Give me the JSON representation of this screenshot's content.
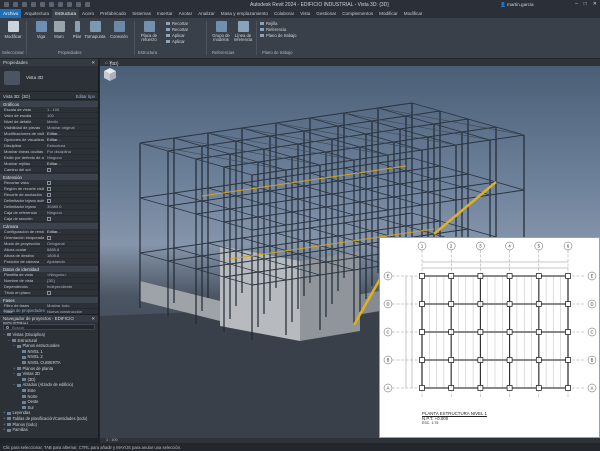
{
  "app": {
    "title": "Autodesk Revit 2024 - EDIFICIO INDUSTRIAL - Vista 3D: {3D}",
    "user": "martin.garcia",
    "window_controls": [
      "–",
      "□",
      "✕"
    ]
  },
  "ribbon_tabs": [
    "Archivo",
    "Arquitectura",
    "Estructura",
    "Acero",
    "Prefabricado",
    "Sistemas",
    "Insertar",
    "Anotar",
    "Analizar",
    "Masa y emplazamiento",
    "Colaborar",
    "Vista",
    "Gestionar",
    "Complementos",
    "Modificar",
    "Modificar"
  ],
  "ribbon": {
    "buttons": [
      {
        "label": "Modificar",
        "icon": "cursor-icon"
      },
      {
        "label": "Viga",
        "icon": "beam-icon"
      },
      {
        "label": "Muro",
        "icon": "wall-icon"
      },
      {
        "label": "Pilar",
        "icon": "column-icon"
      },
      {
        "label": "Tornapunta",
        "icon": "brace-icon"
      },
      {
        "label": "Conexión",
        "icon": "connection-icon"
      },
      {
        "label": "Placa de refuerzo",
        "icon": "plate-icon"
      },
      {
        "label": "Grupo de modelos",
        "icon": "group-icon"
      },
      {
        "label": "Línea de referencia",
        "icon": "ref-line-icon"
      }
    ],
    "list_items": [
      "Recortar",
      "Recortar",
      "Aplicar",
      "Aplicar"
    ],
    "ref_items": [
      "Rejilla",
      "Referencia",
      "Plano de trabajo"
    ],
    "panels": [
      "Seleccionar",
      "Propiedades",
      "Estructura",
      "Referencias",
      "Plano de trabajo"
    ]
  },
  "properties": {
    "title": "Propiedades",
    "type_name": "Vista 3D",
    "instance_filter": "Vista 3D: {3D}",
    "edit_type": "Editar tipo",
    "sections": [
      {
        "name": "Gráficos",
        "rows": [
          {
            "k": "Escala de vista",
            "v": "1 : 100"
          },
          {
            "k": "Valor de escala",
            "v": "100"
          },
          {
            "k": "Nivel de detalle",
            "v": "Medio"
          },
          {
            "k": "Visibilidad de piezas",
            "v": "Mostrar original"
          },
          {
            "k": "Modificaciones de visibilidad",
            "v": "Editar..."
          },
          {
            "k": "Opciones de visualización",
            "v": "Editar..."
          },
          {
            "k": "Disciplina",
            "v": "Estructura"
          },
          {
            "k": "Mostrar líneas ocultas",
            "v": "Por disciplina"
          },
          {
            "k": "Estilo por defecto de análisis",
            "v": "Ninguno"
          },
          {
            "k": "Mostrar rejillas",
            "v": "Editar..."
          },
          {
            "k": "Camino del sol",
            "v": ""
          }
        ]
      },
      {
        "name": "Extensión",
        "rows": [
          {
            "k": "Recortar vista",
            "v": ""
          },
          {
            "k": "Región de recorte visible",
            "v": ""
          },
          {
            "k": "Recorte de anotación",
            "v": ""
          },
          {
            "k": "Delimitador lejano activo",
            "v": ""
          },
          {
            "k": "Delimitador lejano",
            "v": "30480.0"
          },
          {
            "k": "Caja de referencia",
            "v": "Ninguno"
          },
          {
            "k": "Caja de sección",
            "v": ""
          }
        ]
      },
      {
        "name": "Cámara",
        "rows": [
          {
            "k": "Configuración de render",
            "v": "Editar..."
          },
          {
            "k": "Orientación bloqueada",
            "v": ""
          },
          {
            "k": "Modo de proyección",
            "v": "Ortogonal"
          },
          {
            "k": "Altura ocular",
            "v": "6885.8"
          },
          {
            "k": "Altura de destino",
            "v": "1808.8"
          },
          {
            "k": "Posición de cámara",
            "v": "Ajustando"
          }
        ]
      },
      {
        "name": "Datos de identidad",
        "rows": [
          {
            "k": "Plantilla de vista",
            "v": "<Ninguno>"
          },
          {
            "k": "Nombre de vista",
            "v": "{3D}"
          },
          {
            "k": "Dependencia",
            "v": "Independiente"
          },
          {
            "k": "Título en plano",
            "v": ""
          }
        ]
      },
      {
        "name": "Fases",
        "rows": [
          {
            "k": "Filtro de fases",
            "v": "Mostrar todo"
          },
          {
            "k": "Fase",
            "v": "Nueva construcción"
          }
        ]
      }
    ],
    "help_link": "Ayuda de propiedades",
    "apply": "Aplicar"
  },
  "browser": {
    "title": "Navegador de proyectos - EDIFICIO INDUSTRIAL",
    "search_placeholder": "Buscar",
    "tree": [
      {
        "level": 0,
        "toggle": "−",
        "label": "Vistas (Disciplina)"
      },
      {
        "level": 1,
        "toggle": "−",
        "label": "Estructural"
      },
      {
        "level": 2,
        "toggle": "−",
        "label": "Planos estructurales"
      },
      {
        "level": 3,
        "toggle": "",
        "label": "NIVEL 1"
      },
      {
        "level": 3,
        "toggle": "",
        "label": "NIVEL 2"
      },
      {
        "level": 3,
        "toggle": "",
        "label": "NIVEL CUBIERTA"
      },
      {
        "level": 2,
        "toggle": "+",
        "label": "Planos de planta"
      },
      {
        "level": 2,
        "toggle": "−",
        "label": "Vistas 3D"
      },
      {
        "level": 3,
        "toggle": "",
        "label": "{3D}"
      },
      {
        "level": 2,
        "toggle": "−",
        "label": "Alzados (Alzado de edificio)"
      },
      {
        "level": 3,
        "toggle": "",
        "label": "Este"
      },
      {
        "level": 3,
        "toggle": "",
        "label": "Norte"
      },
      {
        "level": 3,
        "toggle": "",
        "label": "Oeste"
      },
      {
        "level": 3,
        "toggle": "",
        "label": "Sur"
      },
      {
        "level": 0,
        "toggle": "+",
        "label": "Leyendas"
      },
      {
        "level": 0,
        "toggle": "+",
        "label": "Tablas de planificación/Cantidades (todo)"
      },
      {
        "level": 0,
        "toggle": "+",
        "label": "Planos (todo)"
      },
      {
        "level": 0,
        "toggle": "+",
        "label": "Familias"
      }
    ]
  },
  "view": {
    "tab": "{3D}",
    "scale": "1 : 100"
  },
  "plan": {
    "grid_cols": [
      "1",
      "2",
      "3",
      "4",
      "5",
      "6"
    ],
    "grid_rows": [
      "A",
      "B",
      "C",
      "D",
      "E"
    ],
    "title": "PLANTA ESTRUCTURA NIVEL 1",
    "subtitle": "N.P.T. +0.000",
    "scale": "ESC. 1:75"
  },
  "status": {
    "text": "Clic para seleccionar, TAB para alternar, CTRL para añadir y MAYÚS para anular una selección."
  }
}
